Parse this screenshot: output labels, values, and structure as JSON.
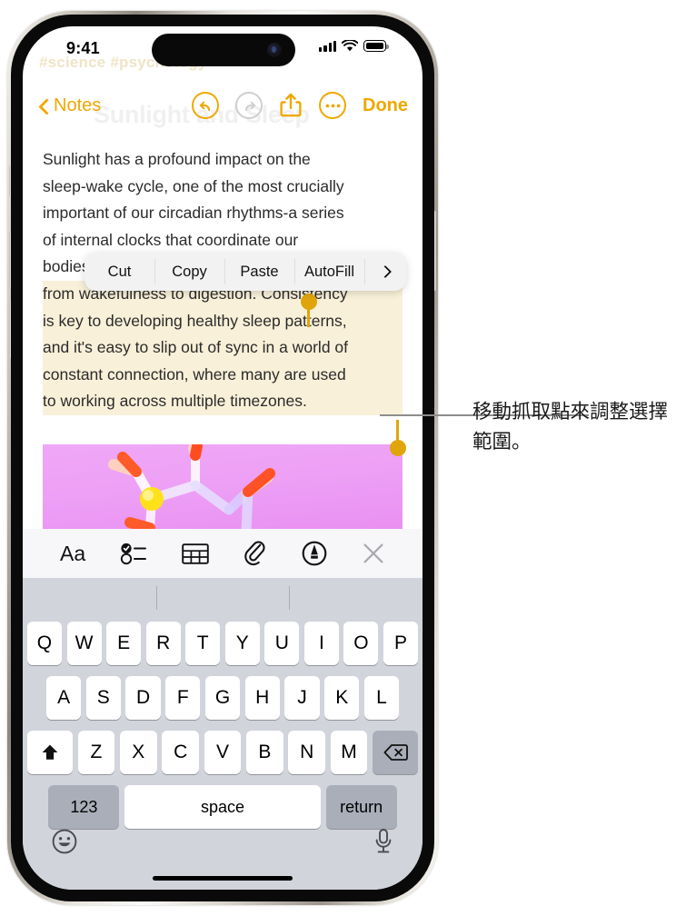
{
  "status_bar": {
    "time": "9:41",
    "signal_icon": "cellular-signal-icon",
    "wifi_icon": "wifi-icon",
    "battery_icon": "battery-full-icon"
  },
  "background": {
    "ghost_tags": "#science  #psychology",
    "ghost_title": "Sunlight and Sleep"
  },
  "nav_bar": {
    "back_label": "Notes",
    "undo_icon": "undo-icon",
    "redo_icon": "redo-icon",
    "share_icon": "share-icon",
    "more_icon": "more-ellipsis-icon",
    "done_label": "Done"
  },
  "note": {
    "lines": [
      {
        "text": "Sunlight has a profound impact on the",
        "highlighted": false
      },
      {
        "text": "sleep-wake cycle, one of the most crucially",
        "highlighted": false
      },
      {
        "text": "important of our circadian rhythms-a series",
        "highlighted": false
      },
      {
        "text": "of internal clocks that coordinate our",
        "highlighted": false
      },
      {
        "text": "bodies' functions to optimize everything",
        "highlighted": false
      },
      {
        "text": "from wakefulness to digestion. Consistency",
        "highlighted": true
      },
      {
        "text": "is key to developing healthy sleep patterns,",
        "highlighted": true
      },
      {
        "text": "and it's easy to slip out of sync in a world of",
        "highlighted": true
      },
      {
        "text": "constant connection, where many are used",
        "highlighted": true
      },
      {
        "text": "to working across multiple timezones.",
        "highlighted": true
      }
    ],
    "selection_start_text": "Consistency",
    "selection_end_text": "timezones.",
    "highlight_color": "#f8f0d8",
    "handle_color": "#e0a50b",
    "attachment": {
      "name": "molecule-image",
      "background_color": "#eda0f5"
    }
  },
  "context_menu": {
    "items": [
      {
        "label": "Cut"
      },
      {
        "label": "Copy"
      },
      {
        "label": "Paste"
      },
      {
        "label": "AutoFill"
      }
    ],
    "more_icon": "chevron-right-icon"
  },
  "format_toolbar": {
    "items": [
      {
        "icon": "text-format-aa-icon",
        "label": "Aa"
      },
      {
        "icon": "checklist-icon",
        "label": ""
      },
      {
        "icon": "table-icon",
        "label": ""
      },
      {
        "icon": "paperclip-attach-icon",
        "label": ""
      },
      {
        "icon": "markup-pen-icon",
        "label": ""
      },
      {
        "icon": "close-x-icon",
        "label": ""
      }
    ]
  },
  "keyboard": {
    "row1": [
      "Q",
      "W",
      "E",
      "R",
      "T",
      "Y",
      "U",
      "I",
      "O",
      "P"
    ],
    "row2": [
      "A",
      "S",
      "D",
      "F",
      "G",
      "H",
      "J",
      "K",
      "L"
    ],
    "row3_letters": [
      "Z",
      "X",
      "C",
      "V",
      "B",
      "N",
      "M"
    ],
    "shift_icon": "shift-arrow-icon",
    "delete_icon": "delete-backspace-icon",
    "numbers_label": "123",
    "space_label": "space",
    "return_label": "return",
    "emoji_icon": "emoji-smiley-icon",
    "dictation_icon": "microphone-icon"
  },
  "annotation": {
    "text": "移動抓取點來調整選擇範圍。",
    "line_color": "#8d8d8d"
  }
}
